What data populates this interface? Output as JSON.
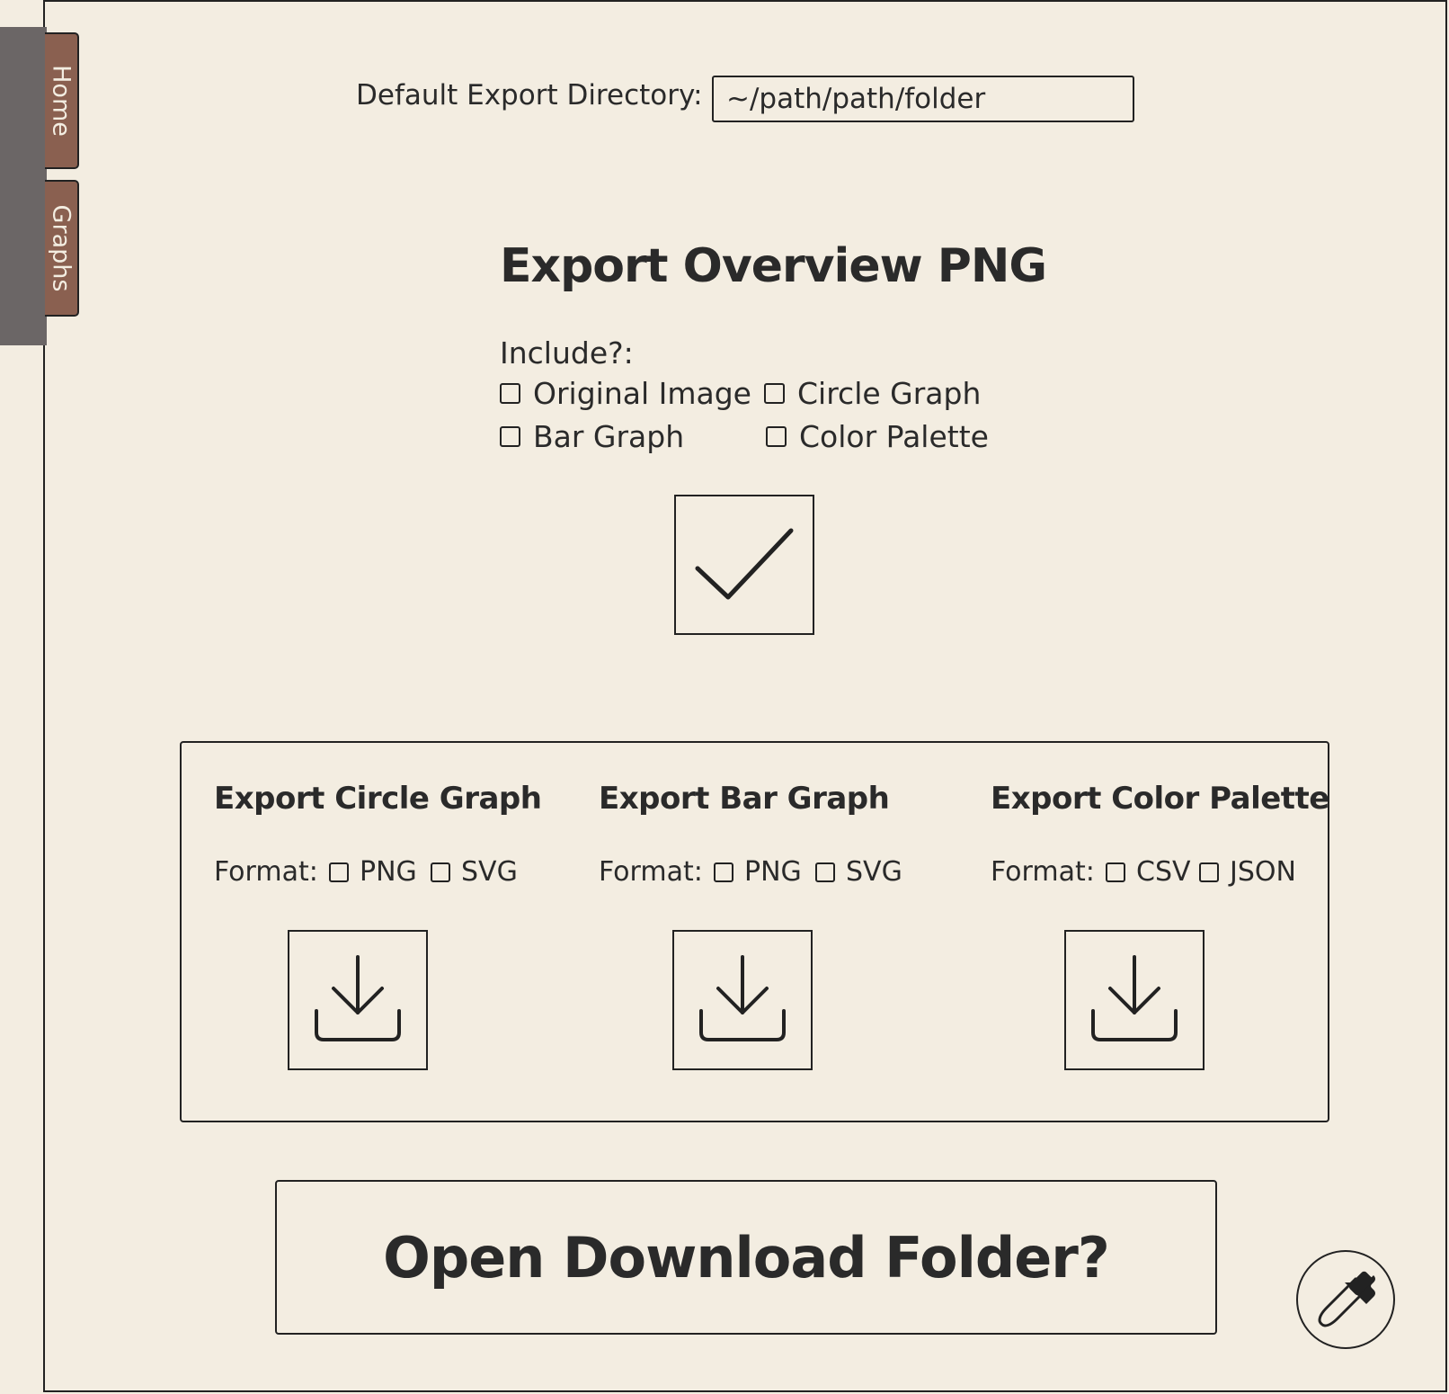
{
  "nav": {
    "tabs": [
      {
        "label": "Home"
      },
      {
        "label": "Graphs"
      }
    ]
  },
  "export_dir": {
    "label": "Default Export Directory:",
    "value": "~/path/path/folder"
  },
  "overview": {
    "title": "Export Overview PNG",
    "include_label": "Include?:",
    "options": [
      "Original Image",
      "Circle Graph",
      "Bar Graph",
      "Color Palette"
    ],
    "confirm_icon": "checkmark-icon"
  },
  "sections": [
    {
      "title": "Export Circle Graph",
      "format_label": "Format:",
      "formats": [
        "PNG",
        "SVG"
      ],
      "icon": "download-icon"
    },
    {
      "title": "Export Bar Graph",
      "format_label": "Format:",
      "formats": [
        "PNG",
        "SVG"
      ],
      "icon": "download-icon"
    },
    {
      "title": "Export Color Palette",
      "format_label": "Format:",
      "formats": [
        "CSV",
        "JSON"
      ],
      "icon": "download-icon"
    }
  ],
  "open_folder": {
    "label": "Open Download Folder?"
  },
  "fab": {
    "icon": "eyedropper-icon"
  },
  "colors": {
    "background": "#f3ede1",
    "tab": "#8a6050",
    "sidebar": "#6b6666",
    "ink": "#222222"
  }
}
